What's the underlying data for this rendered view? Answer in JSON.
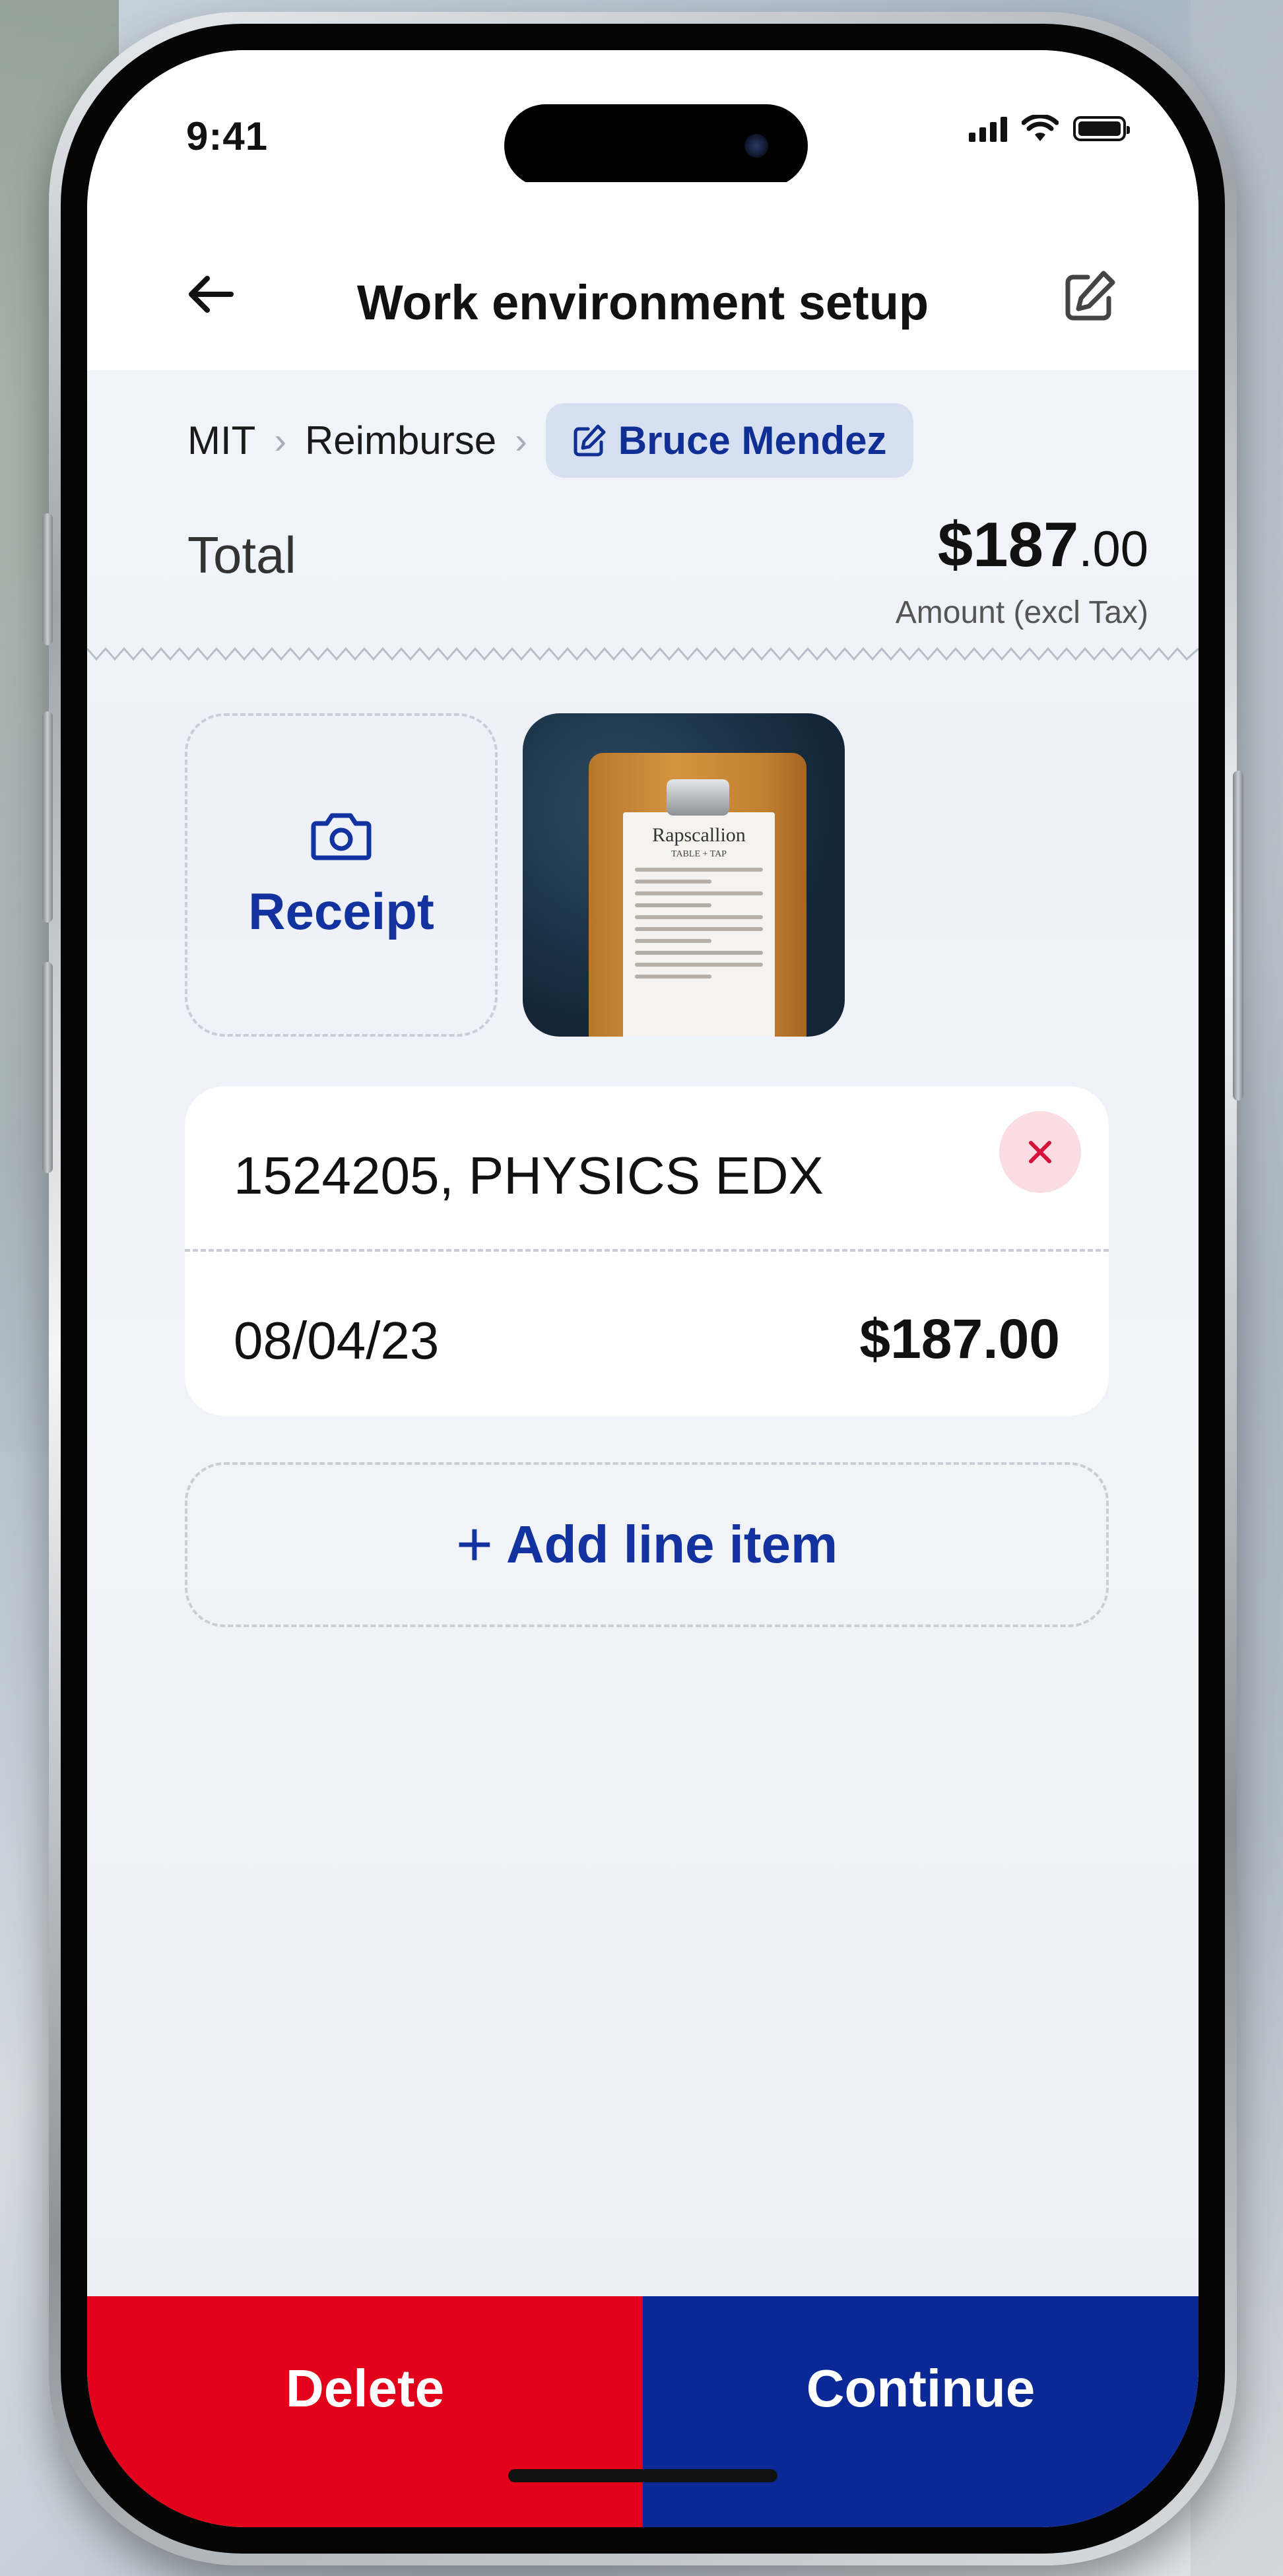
{
  "status_bar": {
    "time": "9:41"
  },
  "header": {
    "title": "Work environment setup"
  },
  "breadcrumb": {
    "items": [
      "MIT",
      "Reimburse"
    ],
    "current": "Bruce Mendez"
  },
  "total": {
    "label": "Total",
    "amount_main": "$187",
    "amount_cents": ".00",
    "subtitle": "Amount (excl Tax)"
  },
  "receipt": {
    "label": "Receipt",
    "thumb_title": "Rapscallion",
    "thumb_subtitle": "TABLE + TAP"
  },
  "line_item": {
    "title": "1524205, PHYSICS EDX",
    "date": "08/04/23",
    "amount": "$187.00"
  },
  "add_line": {
    "label": "Add line item"
  },
  "actions": {
    "delete_label": "Delete",
    "continue_label": "Continue"
  },
  "colors": {
    "accent_blue": "#1232a0",
    "continue_blue": "#0a2896",
    "delete_red": "#e2001a",
    "chip_bg": "#d6e0f0",
    "remove_bg": "#f9dde3"
  },
  "icons": [
    "back-arrow-icon",
    "edit-icon",
    "chevron-right-icon",
    "camera-icon",
    "close-icon",
    "plus-icon",
    "signal-icon",
    "wifi-icon",
    "battery-icon"
  ]
}
